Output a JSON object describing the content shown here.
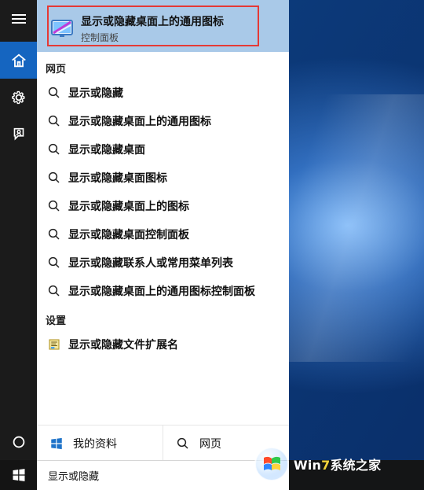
{
  "desktop": {},
  "rail": {
    "items": [
      {
        "name": "hamburger-menu",
        "icon": "hamburger-icon"
      },
      {
        "name": "home",
        "icon": "home-icon"
      },
      {
        "name": "settings",
        "icon": "gear-icon"
      },
      {
        "name": "feedback",
        "icon": "person-chat-icon"
      },
      {
        "name": "cortana",
        "icon": "circle-icon"
      }
    ]
  },
  "top_result": {
    "title": "显示或隐藏桌面上的通用图标",
    "subtitle": "控制面板",
    "icon": "control-panel-icon",
    "highlight_color": "#e53935"
  },
  "sections": {
    "web_title": "网页",
    "settings_title": "设置"
  },
  "web_results": [
    "显示或隐藏",
    "显示或隐藏桌面上的通用图标",
    "显示或隐藏桌面",
    "显示或隐藏桌面图标",
    "显示或隐藏桌面上的图标",
    "显示或隐藏桌面控制面板",
    "显示或隐藏联系人或常用菜单列表",
    "显示或隐藏桌面上的通用图标控制面板"
  ],
  "settings_results": [
    "显示或隐藏文件扩展名"
  ],
  "bottom_actions": {
    "my_stuff": "我的资料",
    "web": "网页"
  },
  "search": {
    "value": "显示或隐藏"
  },
  "watermark": {
    "text_prefix": "Win",
    "text_digit": "7",
    "text_suffix": "系统之家"
  }
}
